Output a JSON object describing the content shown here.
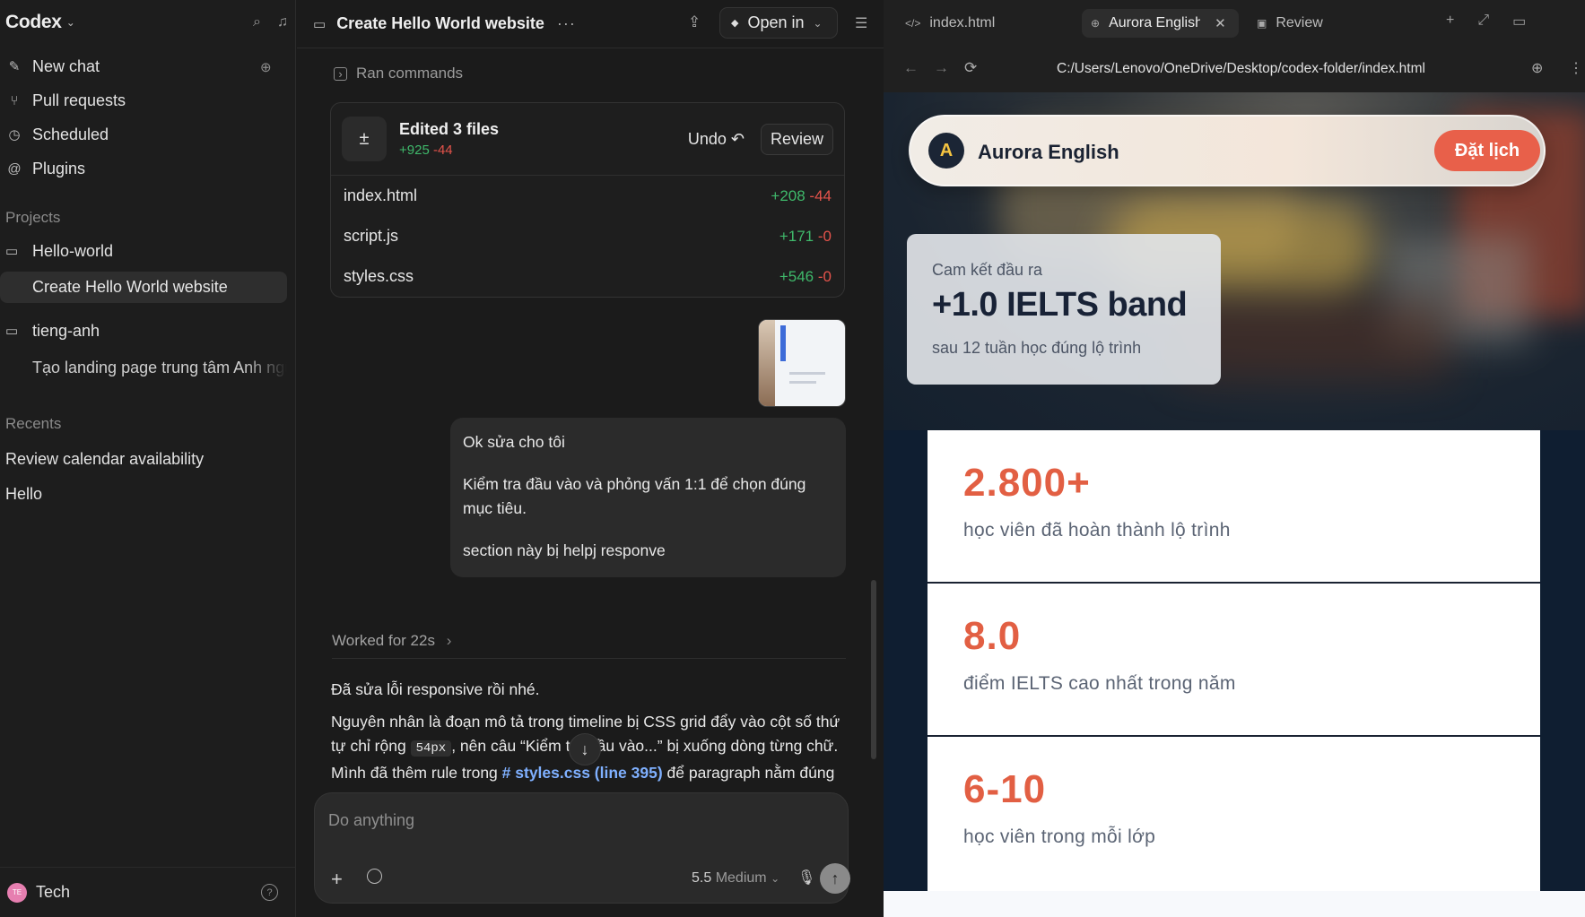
{
  "sidebar": {
    "brand": "Codex",
    "nav": [
      {
        "label": "New chat",
        "icon": "edit-icon"
      },
      {
        "label": "Pull requests",
        "icon": "pull-request-icon"
      },
      {
        "label": "Scheduled",
        "icon": "clock-icon"
      },
      {
        "label": "Plugins",
        "icon": "plugin-icon"
      }
    ],
    "projects_label": "Projects",
    "projects": [
      {
        "label": "Hello-world",
        "threads": [
          "Create Hello World website"
        ]
      },
      {
        "label": "tieng-anh",
        "threads": [
          "Tạo landing page trung tâm Anh ngữ"
        ]
      }
    ],
    "recents_label": "Recents",
    "recents": [
      "Review calendar availability",
      "Hello"
    ],
    "user": {
      "initials": "TE",
      "name": "Tech"
    }
  },
  "chat": {
    "title": "Create Hello World website",
    "open_in": "Open in",
    "ran_commands": "Ran commands",
    "edit_card": {
      "title": "Edited 3 files",
      "added": "+925",
      "removed": "-44",
      "undo": "Undo",
      "review": "Review",
      "files": [
        {
          "name": "index.html",
          "added": "+208",
          "removed": "-44"
        },
        {
          "name": "script.js",
          "added": "+171",
          "removed": "-0"
        },
        {
          "name": "styles.css",
          "added": "+546",
          "removed": "-0"
        }
      ]
    },
    "user_message": {
      "line1": "Ok sửa cho tôi",
      "line2": "Kiểm tra đầu vào và phỏng vấn 1:1 để chọn đúng mục tiêu.",
      "line3": "section này bị helpj responve"
    },
    "worked_for": "Worked for 22s",
    "answer": {
      "p1": "Đã sửa lỗi responsive rồi nhé.",
      "p2_a": "Nguyên nhân là đoạn mô tả trong timeline bị CSS grid đẩy vào cột số thứ tự chỉ rộng",
      "p2_code": "54px",
      "p2_b": ", nên câu “Kiểm tra đầu vào...” bị xuống dòng từng chữ.",
      "p3_a": "Mình đã thêm rule trong",
      "p3_link": "# styles.css (line 395)",
      "p3_b": "để paragraph nằm đúng"
    },
    "composer": {
      "placeholder": "Do anything",
      "model_version": "5.5",
      "model_effort": "Medium"
    }
  },
  "browser": {
    "tabs": [
      {
        "label": "index.html",
        "icon": "code-icon"
      },
      {
        "label": "Aurora English S",
        "icon": "globe-icon"
      },
      {
        "label": "Review",
        "icon": "review-icon"
      }
    ],
    "url": "C:/Users/Lenovo/OneDrive/Desktop/codex-folder/index.html",
    "page": {
      "logo_letter": "A",
      "brand": "Aurora English",
      "cta": "Đặt lịch",
      "promo": {
        "kicker": "Cam kết đầu ra",
        "value": "+1.0 IELTS band",
        "desc": "sau 12 tuần học đúng lộ trình"
      },
      "stats": [
        {
          "num": "2.800+",
          "label": "học viên đã hoàn thành lộ trình"
        },
        {
          "num": "8.0",
          "label": "điểm IELTS cao nhất trong năm"
        },
        {
          "num": "6-10",
          "label": "học viên trong mỗi lớp"
        }
      ]
    }
  },
  "colors": {
    "accent": "#e8604a",
    "add": "#3fb96b",
    "remove": "#e5534b",
    "link": "#7fb0ff"
  }
}
